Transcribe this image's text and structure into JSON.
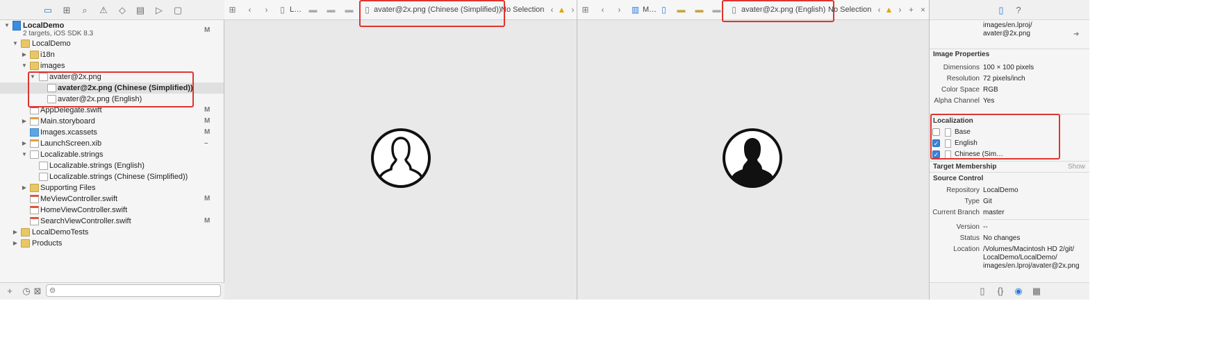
{
  "navigator": {
    "items": [
      {
        "label": "LocalDemo",
        "sub": "2 targets, iOS SDK 8.3",
        "badge": "M"
      },
      {
        "label": "LocalDemo",
        "badge": ""
      },
      {
        "label": "i18n",
        "badge": ""
      },
      {
        "label": "images",
        "badge": ""
      },
      {
        "label": "avater@2x.png",
        "badge": ""
      },
      {
        "label": "avater@2x.png (Chinese (Simplified))",
        "badge": ""
      },
      {
        "label": "avater@2x.png (English)",
        "badge": ""
      },
      {
        "label": "AppDelegate.swift",
        "badge": "M"
      },
      {
        "label": "Main.storyboard",
        "badge": "M"
      },
      {
        "label": "Images.xcassets",
        "badge": "M"
      },
      {
        "label": "LaunchScreen.xib",
        "badge": "–"
      },
      {
        "label": "Localizable.strings",
        "badge": ""
      },
      {
        "label": "Localizable.strings (English)",
        "badge": ""
      },
      {
        "label": "Localizable.strings (Chinese (Simplified))",
        "badge": ""
      },
      {
        "label": "Supporting Files",
        "badge": ""
      },
      {
        "label": "MeViewController.swift",
        "badge": "M"
      },
      {
        "label": "HomeViewController.swift",
        "badge": ""
      },
      {
        "label": "SearchViewController.swift",
        "badge": "M"
      },
      {
        "label": "LocalDemoTests",
        "badge": ""
      },
      {
        "label": "Products",
        "badge": ""
      }
    ]
  },
  "editor_left": {
    "crumb1": "L…",
    "file": "avater@2x.png (Chinese (Simplified))",
    "selection": "No Selection"
  },
  "editor_right": {
    "crumb1": "M…",
    "file": "avater@2x.png (English)",
    "selection": "No Selection"
  },
  "inspector": {
    "path_lines": [
      "images/en.lproj/",
      "avater@2x.png"
    ],
    "image_properties_title": "Image Properties",
    "image_properties": [
      {
        "k": "Dimensions",
        "v": "100 × 100 pixels"
      },
      {
        "k": "Resolution",
        "v": "72 pixels/inch"
      },
      {
        "k": "Color Space",
        "v": "RGB"
      },
      {
        "k": "Alpha Channel",
        "v": "Yes"
      }
    ],
    "localization_title": "Localization",
    "localizations": [
      {
        "label": "Base",
        "checked": false
      },
      {
        "label": "English",
        "checked": true
      },
      {
        "label": "Chinese (Sim…",
        "checked": true
      }
    ],
    "target_membership_title": "Target Membership",
    "show_label": "Show",
    "source_control_title": "Source Control",
    "source_control": [
      {
        "k": "Repository",
        "v": "LocalDemo"
      },
      {
        "k": "Type",
        "v": "Git"
      },
      {
        "k": "Current Branch",
        "v": "master"
      },
      {
        "k": "Version",
        "v": "--"
      },
      {
        "k": "Status",
        "v": "No changes"
      }
    ],
    "location_key": "Location",
    "location_lines": [
      "/Volumes/Macintosh HD 2/git/",
      "LocalDemo/LocalDemo/",
      "images/en.lproj/avater@2x.png"
    ]
  },
  "colors": {
    "highlight": "#e0332e",
    "accent": "#3b82d8",
    "folder": "#e8c766"
  }
}
